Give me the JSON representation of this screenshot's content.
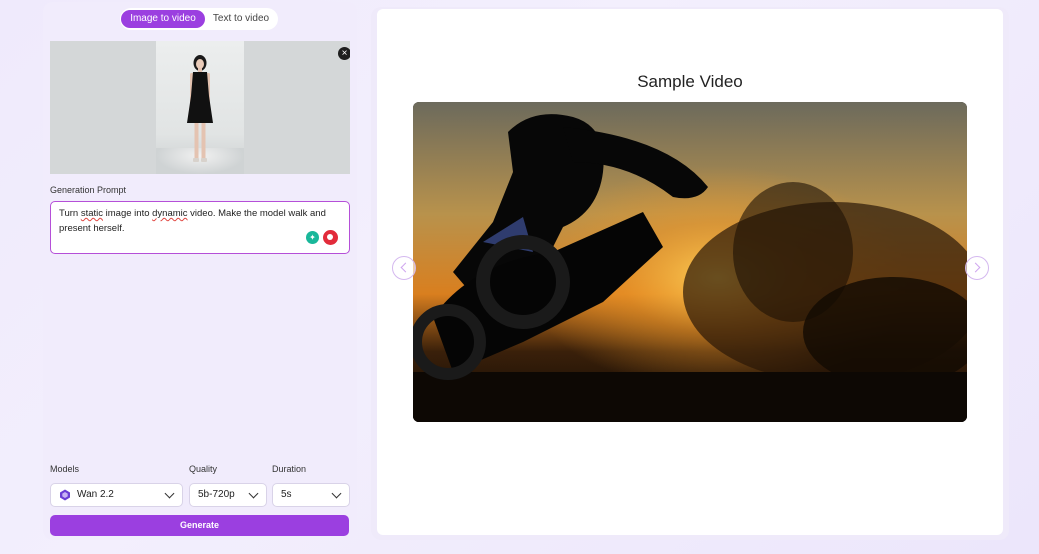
{
  "mode_switch": {
    "active_label": "Image to video",
    "inactive_label": "Text to video"
  },
  "uploaded_image": {
    "remove_label": "×"
  },
  "prompt": {
    "label": "Generation Prompt",
    "text_before_1": "Turn ",
    "word_1": "static",
    "text_between": " image into ",
    "word_2": "dynamic",
    "text_after": " video. Make the model walk and present herself."
  },
  "settings": {
    "models_label": "Models",
    "model_value": "Wan 2.2",
    "quality_label": "Quality",
    "quality_value": "5b-720p",
    "duration_label": "Duration",
    "duration_value": "5s"
  },
  "generate_label": "Generate",
  "preview": {
    "title": "Sample Video"
  },
  "colors": {
    "accent": "#9b3fe0",
    "panel_bg": "#f1ecfc"
  }
}
